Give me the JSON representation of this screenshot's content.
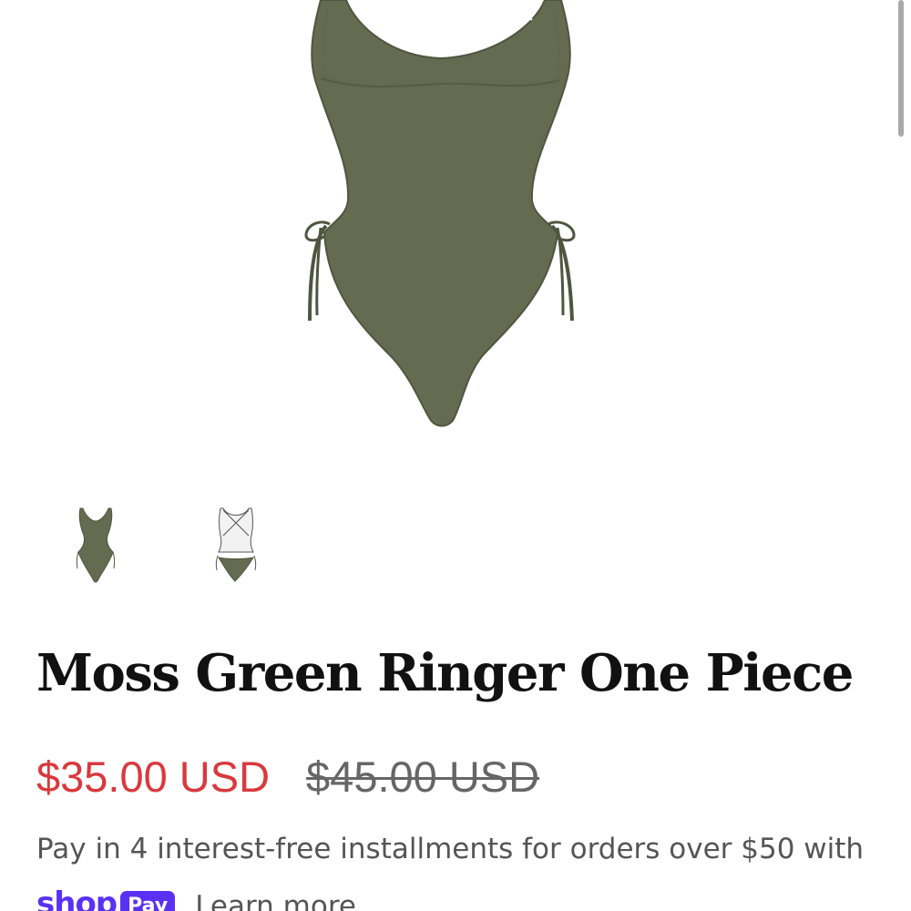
{
  "product": {
    "title": "Moss Green Ringer One Piece",
    "sale_price": "$35.00 USD",
    "compare_price": "$45.00 USD",
    "swimsuit_color": "#646b50",
    "close_icon": "close-icon"
  },
  "gallery": {
    "thumbnails": [
      {
        "name": "front-view",
        "color": "#646b50"
      },
      {
        "name": "back-view",
        "color": "#f2f2f2"
      }
    ]
  },
  "payment": {
    "installments_text": "Pay in 4 interest-free installments for orders over $50 with",
    "shop_word": "shop",
    "pay_badge": "Pay",
    "learn_more": "Learn more",
    "brand_color": "#5a31f4"
  },
  "colors": {
    "sale": "#d9393e",
    "compare": "#666666",
    "text": "#111111"
  }
}
